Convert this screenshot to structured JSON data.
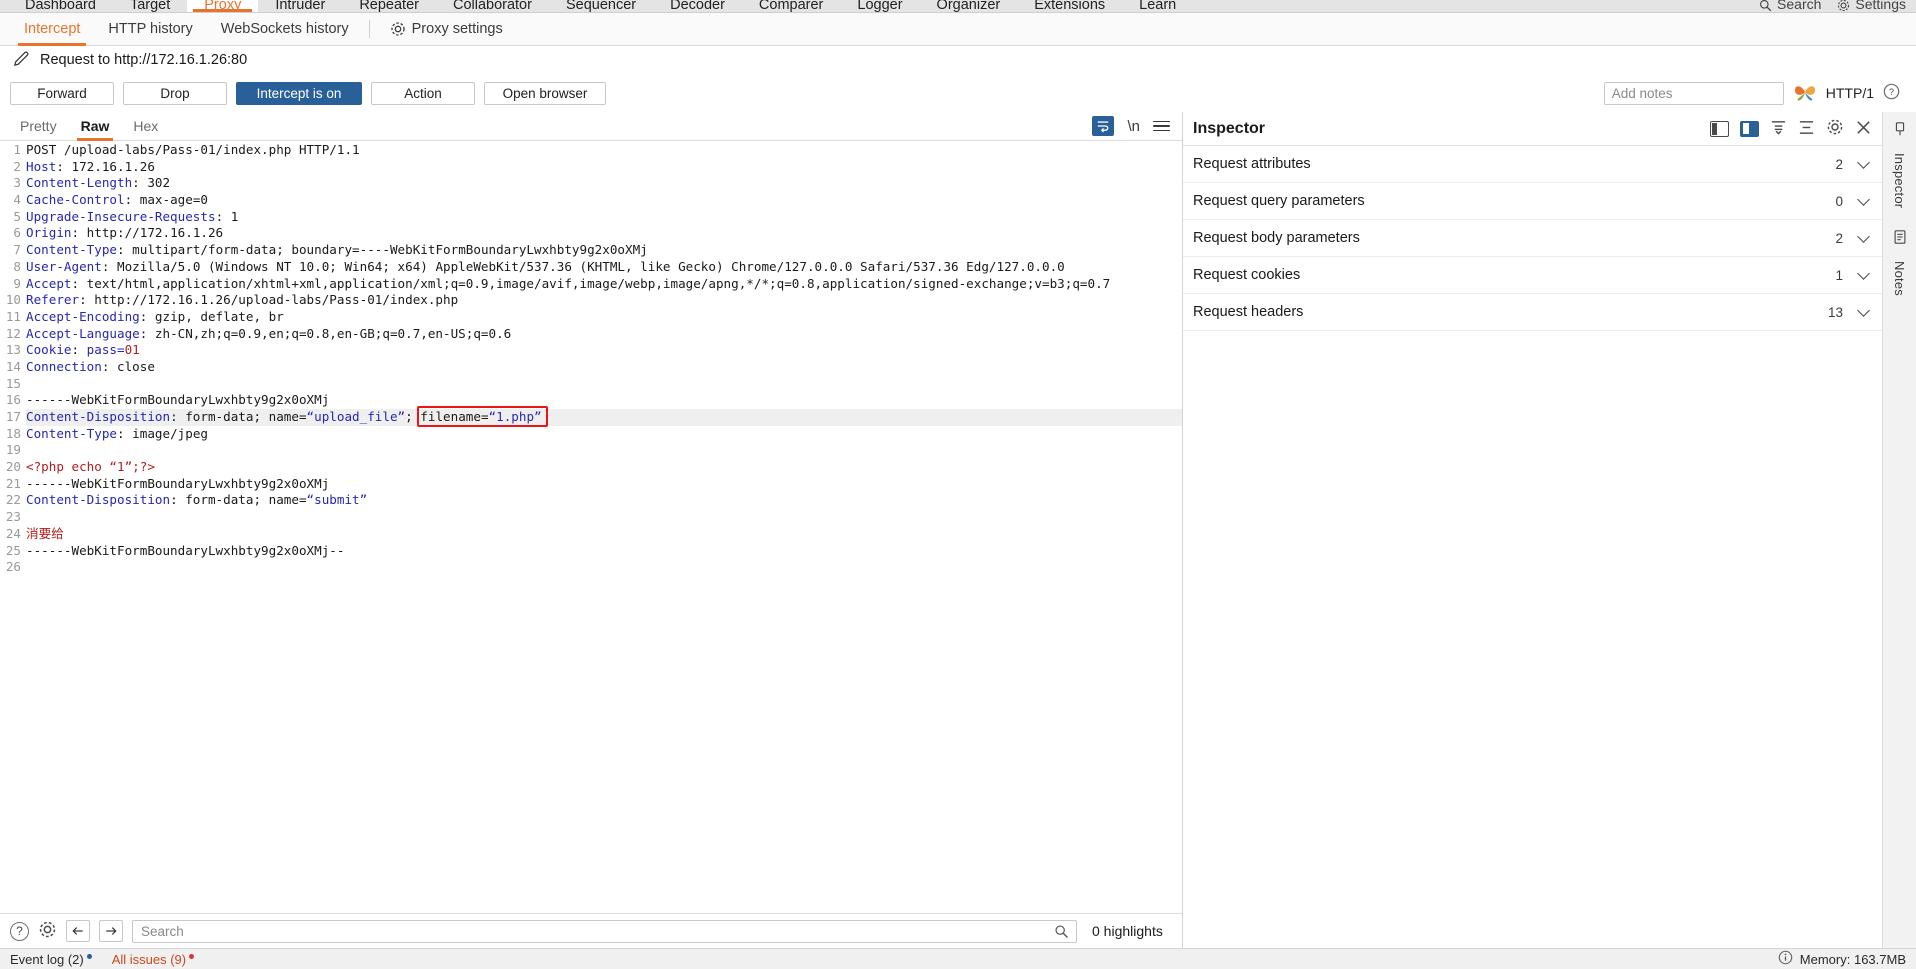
{
  "main_tabs": [
    {
      "label": "Dashboard",
      "active": false
    },
    {
      "label": "Target",
      "active": false
    },
    {
      "label": "Proxy",
      "active": true
    },
    {
      "label": "Intruder",
      "active": false
    },
    {
      "label": "Repeater",
      "active": false
    },
    {
      "label": "Collaborator",
      "active": false
    },
    {
      "label": "Sequencer",
      "active": false
    },
    {
      "label": "Decoder",
      "active": false
    },
    {
      "label": "Comparer",
      "active": false
    },
    {
      "label": "Logger",
      "active": false
    },
    {
      "label": "Organizer",
      "active": false
    },
    {
      "label": "Extensions",
      "active": false
    },
    {
      "label": "Learn",
      "active": false
    }
  ],
  "main_tabs_right": [
    {
      "label": "Search",
      "icon": "search-icon"
    },
    {
      "label": "Settings",
      "icon": "gear-icon"
    }
  ],
  "sub_tabs": [
    {
      "label": "Intercept",
      "active": true
    },
    {
      "label": "HTTP history",
      "active": false
    },
    {
      "label": "WebSockets history",
      "active": false
    }
  ],
  "proxy_settings": {
    "label": "Proxy settings",
    "icon": "gear-icon"
  },
  "request_title": {
    "text": "Request to http://172.16.1.26:80",
    "icon": "pencil-icon"
  },
  "toolbar": {
    "forward": "Forward",
    "drop": "Drop",
    "intercept_toggle": "Intercept is on",
    "action": "Action",
    "open_browser": "Open browser",
    "notes_placeholder": "Add notes",
    "http_version": "HTTP/1",
    "help_icon": "help-icon",
    "butterfly_icon": "butterfly-icon"
  },
  "editor": {
    "tabs": [
      {
        "label": "Pretty",
        "active": false
      },
      {
        "label": "Raw",
        "active": true
      },
      {
        "label": "Hex",
        "active": false
      }
    ],
    "wrap_icon": "word-wrap-icon",
    "newline_label": "\\n",
    "menu_icon": "hamburger-icon"
  },
  "request_lines": [
    {
      "n": 1,
      "segments": [
        {
          "t": "POST /upload-labs/Pass-01/index.php HTTP/1.1",
          "c": "hdr-val"
        }
      ]
    },
    {
      "n": 2,
      "segments": [
        {
          "t": "Host",
          "c": "hdr-name"
        },
        {
          "t": ": 172.16.1.26",
          "c": "hdr-val"
        }
      ]
    },
    {
      "n": 3,
      "segments": [
        {
          "t": "Content-Length",
          "c": "hdr-name"
        },
        {
          "t": ": 302",
          "c": "hdr-val"
        }
      ]
    },
    {
      "n": 4,
      "segments": [
        {
          "t": "Cache-Control",
          "c": "hdr-name"
        },
        {
          "t": ": max-age=0",
          "c": "hdr-val"
        }
      ]
    },
    {
      "n": 5,
      "segments": [
        {
          "t": "Upgrade-Insecure-Requests",
          "c": "hdr-name"
        },
        {
          "t": ": 1",
          "c": "hdr-val"
        }
      ]
    },
    {
      "n": 6,
      "segments": [
        {
          "t": "Origin",
          "c": "hdr-name"
        },
        {
          "t": ": http://172.16.1.26",
          "c": "hdr-val"
        }
      ]
    },
    {
      "n": 7,
      "segments": [
        {
          "t": "Content-Type",
          "c": "hdr-name"
        },
        {
          "t": ": multipart/form-data; boundary=----WebKitFormBoundaryLwxhbty9g2x0oXMj",
          "c": "hdr-val"
        }
      ]
    },
    {
      "n": 8,
      "segments": [
        {
          "t": "User-Agent",
          "c": "hdr-name"
        },
        {
          "t": ": Mozilla/5.0 (Windows NT 10.0; Win64; x64) AppleWebKit/537.36 (KHTML, like Gecko) Chrome/127.0.0.0 Safari/537.36 Edg/127.0.0.0",
          "c": "hdr-val"
        }
      ]
    },
    {
      "n": 9,
      "segments": [
        {
          "t": "Accept",
          "c": "hdr-name"
        },
        {
          "t": ": text/html,application/xhtml+xml,application/xml;q=0.9,image/avif,image/webp,image/apng,*/*;q=0.8,application/signed-exchange;v=b3;q=0.7",
          "c": "hdr-val"
        }
      ]
    },
    {
      "n": 10,
      "segments": [
        {
          "t": "Referer",
          "c": "hdr-name"
        },
        {
          "t": ": http://172.16.1.26/upload-labs/Pass-01/index.php",
          "c": "hdr-val"
        }
      ]
    },
    {
      "n": 11,
      "segments": [
        {
          "t": "Accept-Encoding",
          "c": "hdr-name"
        },
        {
          "t": ": gzip, deflate, br",
          "c": "hdr-val"
        }
      ]
    },
    {
      "n": 12,
      "segments": [
        {
          "t": "Accept-Language",
          "c": "hdr-name"
        },
        {
          "t": ": zh-CN,zh;q=0.9,en;q=0.8,en-GB;q=0.7,en-US;q=0.6",
          "c": "hdr-val"
        }
      ]
    },
    {
      "n": 13,
      "segments": [
        {
          "t": "Cookie",
          "c": "hdr-name"
        },
        {
          "t": ": ",
          "c": "hdr-val"
        },
        {
          "t": "pass=",
          "c": "str"
        },
        {
          "t": "01",
          "c": "cookieval"
        }
      ]
    },
    {
      "n": 14,
      "segments": [
        {
          "t": "Connection",
          "c": "hdr-name"
        },
        {
          "t": ": close",
          "c": "hdr-val"
        }
      ]
    },
    {
      "n": 15,
      "segments": []
    },
    {
      "n": 16,
      "segments": [
        {
          "t": "------WebKitFormBoundaryLwxhbty9g2x0oXMj",
          "c": "boundary"
        }
      ]
    },
    {
      "n": 17,
      "highlight": true,
      "segments": [
        {
          "t": "Content-Disposition",
          "c": "hdr-name"
        },
        {
          "t": ": form-data; name=",
          "c": "hdr-val"
        },
        {
          "t": "“upload_file”",
          "c": "str"
        },
        {
          "t": "; filename=",
          "c": "hdr-val"
        },
        {
          "t": "“1.php”",
          "c": "str"
        }
      ]
    },
    {
      "n": 18,
      "segments": [
        {
          "t": "Content-Type",
          "c": "hdr-name"
        },
        {
          "t": ": image/jpeg",
          "c": "hdr-val"
        }
      ]
    },
    {
      "n": 19,
      "segments": []
    },
    {
      "n": 20,
      "segments": [
        {
          "t": "<?php echo “1”;?>",
          "c": "php"
        }
      ]
    },
    {
      "n": 21,
      "segments": [
        {
          "t": "------WebKitFormBoundaryLwxhbty9g2x0oXMj",
          "c": "boundary"
        }
      ]
    },
    {
      "n": 22,
      "segments": [
        {
          "t": "Content-Disposition",
          "c": "hdr-name"
        },
        {
          "t": ": form-data; name=",
          "c": "hdr-val"
        },
        {
          "t": "“submit”",
          "c": "str"
        }
      ]
    },
    {
      "n": 23,
      "segments": []
    },
    {
      "n": 24,
      "segments": [
        {
          "t": "消要给",
          "c": "cjk"
        }
      ]
    },
    {
      "n": 25,
      "segments": [
        {
          "t": "------WebKitFormBoundaryLwxhbty9g2x0oXMj--",
          "c": "boundary"
        }
      ]
    },
    {
      "n": 26,
      "segments": []
    }
  ],
  "annotation": {
    "target_text": "filename=“1.php”",
    "color": "#ef1414"
  },
  "editor_foot": {
    "help_icon": "help-icon",
    "settings_icon": "gear-icon",
    "prev_icon": "arrow-left-icon",
    "next_icon": "arrow-right-icon",
    "search_placeholder": "Search",
    "search_icon": "magnifier-icon",
    "highlights": "0 highlights"
  },
  "inspector": {
    "title": "Inspector",
    "rows": [
      {
        "label": "Request attributes",
        "count": "2"
      },
      {
        "label": "Request query parameters",
        "count": "0"
      },
      {
        "label": "Request body parameters",
        "count": "2"
      },
      {
        "label": "Request cookies",
        "count": "1"
      },
      {
        "label": "Request headers",
        "count": "13"
      }
    ],
    "header_icons": [
      "layout-left-icon",
      "layout-right-icon",
      "collapse-all-icon",
      "expand-all-icon",
      "gear-icon",
      "close-icon"
    ]
  },
  "rail": {
    "items": [
      {
        "icon": "pin-icon",
        "label": ""
      },
      {
        "label": "Inspector"
      },
      {
        "icon": "notes-icon",
        "label": ""
      },
      {
        "label": "Notes"
      }
    ]
  },
  "statusbar": {
    "event_log": "Event log (2)",
    "all_issues": "All issues (9)",
    "memory": "Memory: 163.7MB",
    "memory_icon": "info-icon"
  },
  "colors": {
    "accent": "#e8732c",
    "primary": "#2a6099",
    "annotation": "#ef1414",
    "header_name": "#2727b0",
    "php_red": "#b02020"
  }
}
